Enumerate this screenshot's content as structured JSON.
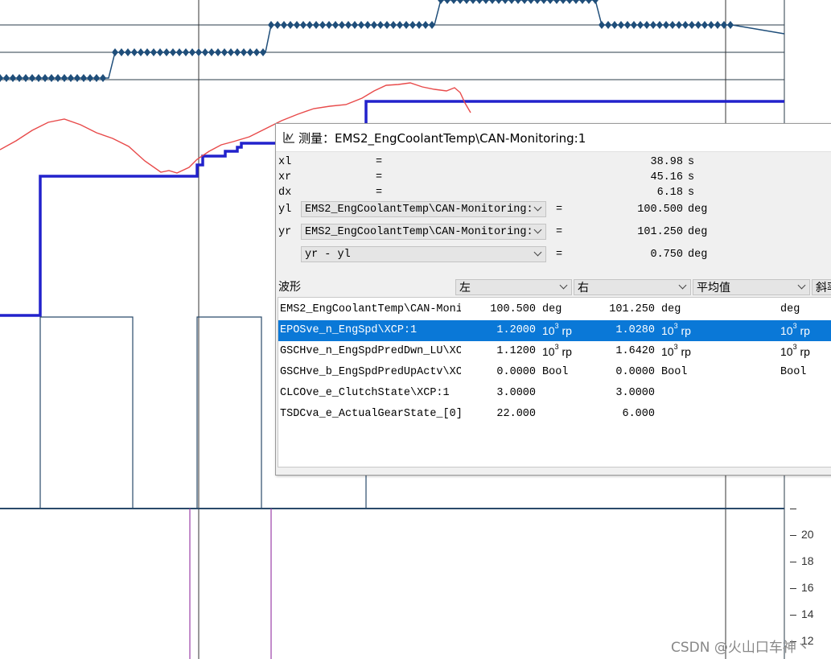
{
  "axis": {
    "ticks": [
      "20",
      "18",
      "16",
      "14",
      "12"
    ]
  },
  "watermark": "CSDN @火山口车神丶",
  "dialog": {
    "title": "测量：EMS2_EngCoolantTemp\\CAN-Monitoring:1",
    "icon": "measure-icon",
    "rows": {
      "xl": {
        "label": "xl",
        "eq": "=",
        "value": "38.98",
        "unit": "s"
      },
      "xr": {
        "label": "xr",
        "eq": "=",
        "value": "45.16",
        "unit": "s"
      },
      "dx": {
        "label": "dx",
        "eq": "=",
        "value": "6.18",
        "unit": "s"
      },
      "yl": {
        "label": "yl",
        "select": "EMS2_EngCoolantTemp\\CAN-Monitoring:",
        "eq": "=",
        "value": "100.500",
        "unit": "deg"
      },
      "yr": {
        "label": "yr",
        "select": "EMS2_EngCoolantTemp\\CAN-Monitoring:",
        "eq": "=",
        "value": "101.250",
        "unit": "deg"
      },
      "diff": {
        "select": "yr - yl",
        "eq": "=",
        "value": "0.750",
        "unit": "deg"
      }
    },
    "table_header": {
      "waveform": "波形",
      "left": "左",
      "right": "右",
      "average": "平均值",
      "slope": "斜率"
    },
    "table": [
      {
        "name": "EMS2_EngCoolantTemp\\CAN-Moni",
        "left": "100.500",
        "left_unit": "deg",
        "right": "101.250",
        "right_unit": "deg",
        "avg_unit": "deg",
        "selected": false
      },
      {
        "name": "EPOSve_n_EngSpd\\XCP:1",
        "left": "1.2000",
        "left_unit": "10³ rp",
        "right": "1.0280",
        "right_unit": "10³ rp",
        "avg_unit": "10³ rp",
        "selected": true
      },
      {
        "name": "GSCHve_n_EngSpdPredDwn_LU\\XC",
        "left": "1.1200",
        "left_unit": "10³ rp",
        "right": "1.6420",
        "right_unit": "10³ rp",
        "avg_unit": "10³ rp",
        "selected": false
      },
      {
        "name": "GSCHve_b_EngSpdPredUpActv\\XC",
        "left": "0.0000",
        "left_unit": "Bool",
        "right": "0.0000",
        "right_unit": "Bool",
        "avg_unit": "Bool",
        "selected": false
      },
      {
        "name": "CLCOve_e_ClutchState\\XCP:1",
        "left": "3.0000",
        "left_unit": "",
        "right": "3.0000",
        "right_unit": "",
        "avg_unit": "",
        "selected": false
      },
      {
        "name": "TSDCva_e_ActualGearState_[0]",
        "left": "22.000",
        "left_unit": "",
        "right": "6.000",
        "right_unit": "",
        "avg_unit": "",
        "selected": false
      }
    ]
  },
  "colors": {
    "background": "#ffffff",
    "grid": "#2a3b4a",
    "diamond_trace": "#1f4e7a",
    "blue_step": "#2222cc",
    "red_trace": "#e84a4a",
    "purple_cursor": "#9b3fa8",
    "selection": "#0a78d7"
  }
}
